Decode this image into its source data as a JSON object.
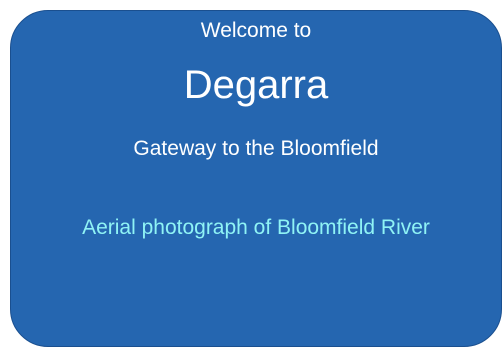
{
  "sign": {
    "welcome_text": "Welcome to",
    "town_name": "Degarra",
    "tagline": "Gateway to the Bloomfield",
    "photo_caption": "Aerial photograph of Bloomfield River"
  },
  "colors": {
    "panel": "#2566b0",
    "text": "#ffffff",
    "caption": "#8ff3f5"
  }
}
